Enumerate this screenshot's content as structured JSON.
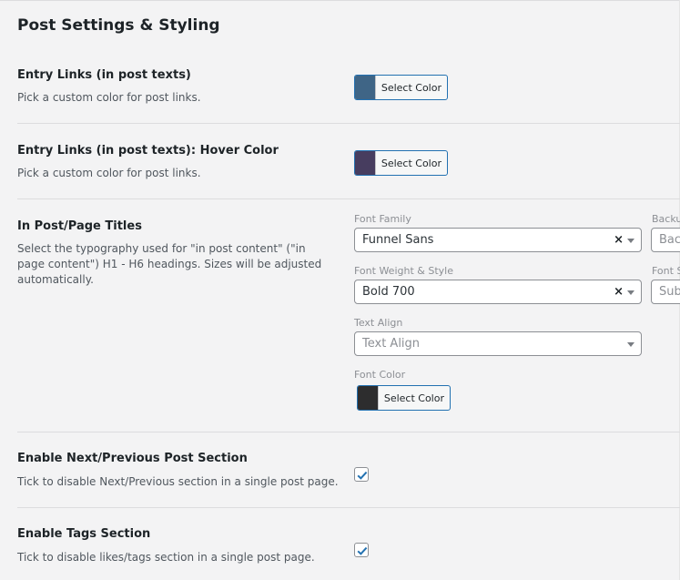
{
  "page": {
    "title": "Post Settings & Styling"
  },
  "common": {
    "select_color_label": "Select Color"
  },
  "rows": [
    {
      "label": "Entry Links (in post texts)",
      "description": "Pick a custom color for post links.",
      "swatch_color": "#3f6586"
    },
    {
      "label": "Entry Links (in post texts): Hover Color",
      "description": "Pick a custom color for post links.",
      "swatch_color": "#473d5f"
    }
  ],
  "titles": {
    "label": "In Post/Page Titles",
    "description": "Select the typography used for \"in post content\" (\"in page content\") H1 - H6 headings. Sizes will be adjusted automatically.",
    "font_family": {
      "label": "Font Family",
      "value": "Funnel Sans"
    },
    "backup_font": {
      "label": "Backu",
      "placeholder": "Bac"
    },
    "font_weight": {
      "label": "Font Weight & Style",
      "value": "Bold 700"
    },
    "font_subsets": {
      "label": "Font S",
      "placeholder": "Sub"
    },
    "text_align": {
      "label": "Text Align",
      "placeholder": "Text Align"
    },
    "font_color": {
      "label": "Font Color",
      "swatch_color": "#2d2d2e"
    }
  },
  "next_prev": {
    "label": "Enable Next/Previous Post Section",
    "description": "Tick to disable Next/Previous section in a single post page.",
    "checked": true
  },
  "tags": {
    "label": "Enable Tags Section",
    "description": "Tick to disable likes/tags section in a single post page.",
    "checked": true
  },
  "colors": {
    "accent": "#2271b1",
    "border": "#dcdcde",
    "background": "#f3f3f4"
  }
}
